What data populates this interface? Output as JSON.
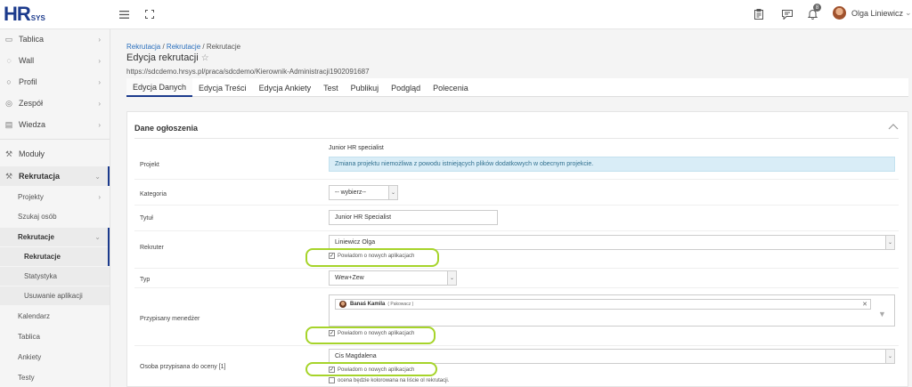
{
  "brand": {
    "hr": "HR",
    "sys": "SYS"
  },
  "topbar": {
    "menu_icon": "hamburger-icon",
    "expand_icon": "fullscreen-icon",
    "clipboard_icon": "clipboard-icon",
    "chat_icon": "chat-icon",
    "bell_icon": "bell-icon",
    "notifications_count": "8",
    "user_name": "Olga Liniewicz",
    "user_caret": "⌄"
  },
  "sidebar": {
    "items": [
      {
        "label": "Tablica",
        "icon": "monitor-icon"
      },
      {
        "label": "Wall",
        "icon": "chat-bubbles-icon"
      },
      {
        "label": "Profil",
        "icon": "user-icon"
      },
      {
        "label": "Zespół",
        "icon": "team-icon"
      },
      {
        "label": "Wiedza",
        "icon": "book-icon"
      },
      {
        "label": "Moduły",
        "icon": "wrench-icon"
      },
      {
        "label": "Rekrutacja",
        "icon": "wrench-icon"
      }
    ],
    "sub": {
      "projekty": "Projekty",
      "szukaj": "Szukaj osób",
      "rekrutacje": "Rekrutacje",
      "rekrutacje_active": "Rekrutacje",
      "statystyka": "Statystyka",
      "usuwanie": "Usuwanie aplikacji",
      "kalendarz": "Kalendarz",
      "tablica": "Tablica",
      "ankiety": "Ankiety",
      "testy": "Testy"
    }
  },
  "breadcrumb": {
    "a": "Rekrutacja",
    "sep1": " / ",
    "b": "Rekrutacje",
    "sep2": " / ",
    "c": "Rekrutacje"
  },
  "page": {
    "title": "Edycja rekrutacji",
    "star": "☆",
    "url": "https://sdcdemo.hrsys.pl/praca/sdcdemo/Kierownik-Administracji1902091687"
  },
  "tabs": [
    "Edycja Danych",
    "Edycja Treści",
    "Edycja Ankiety",
    "Test",
    "Publikuj",
    "Podgląd",
    "Polecenia"
  ],
  "panel": {
    "title": "Dane ogłoszenia",
    "projekt": {
      "label": "Projekt",
      "value": "Junior HR specialist",
      "info": "Zmiana projektu niemożliwa z powodu istniejących plików dodatkowych w obecnym projekcie."
    },
    "kategoria": {
      "label": "Kategoria",
      "value": "-- wybierz--"
    },
    "tytul": {
      "label": "Tytuł",
      "value": "Junior HR Specialist"
    },
    "rekruter": {
      "label": "Rekruter",
      "value": "Liniewicz Olga",
      "notify": "Powiadom o nowych aplikacjach"
    },
    "typ": {
      "label": "Typ",
      "value": "Wew+Zew"
    },
    "menedzer": {
      "label": "Przypisany menedżer",
      "tag_name": "Banaś Kamila",
      "tag_extra": "( Pakowacz )",
      "notify": "Powiadom o nowych aplikacjach"
    },
    "ocena": {
      "label": "Osoba przypisana do oceny [1]",
      "value": "Cis Magdalena",
      "notify": "Powiadom o nowych aplikacjach",
      "extra": "ocena będzie kolorowana na liście ol rekrutacji."
    }
  },
  "colors": {
    "brand": "#1b3a8c",
    "highlight": "#a6d42a",
    "info_bg": "#d9edf7"
  }
}
